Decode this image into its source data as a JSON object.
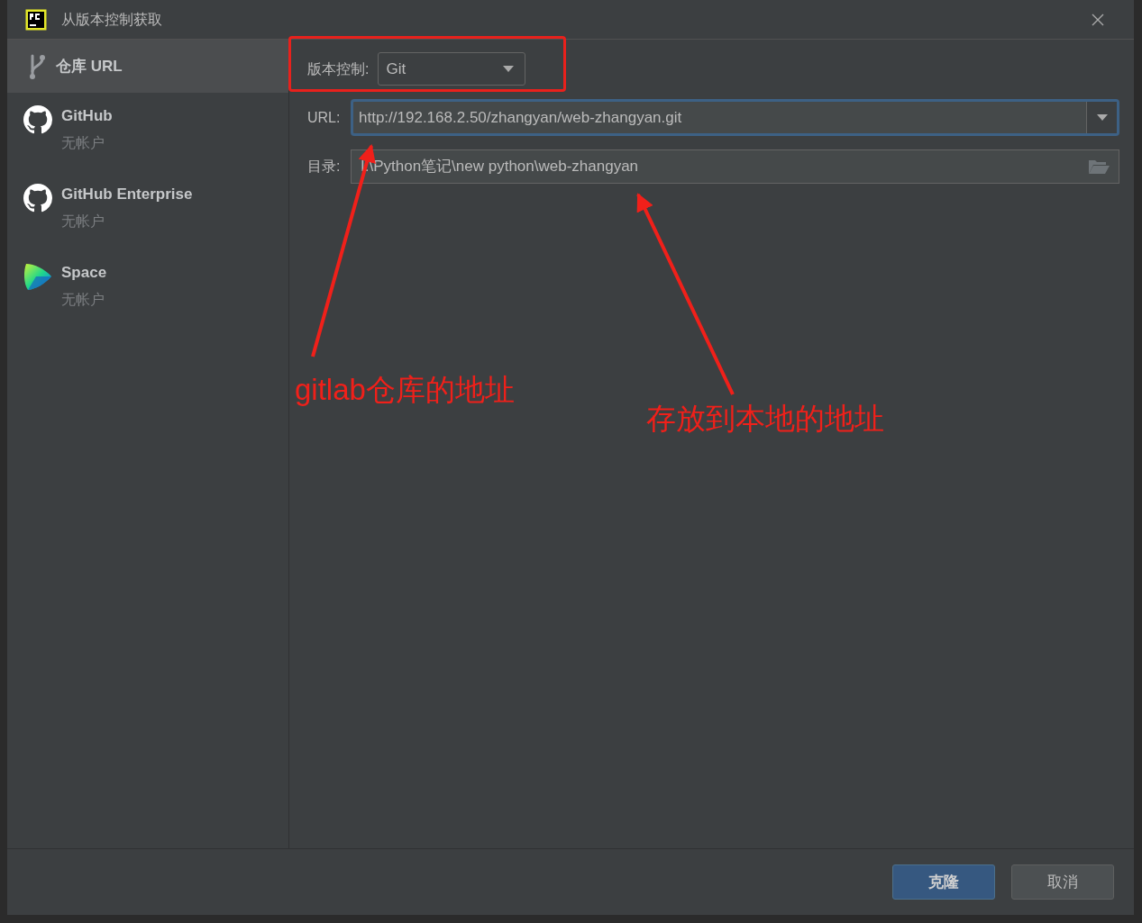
{
  "window": {
    "title": "从版本控制获取"
  },
  "sidebar": {
    "items": [
      {
        "kind": "url",
        "label": "仓库 URL",
        "selected": true
      },
      {
        "kind": "github",
        "label": "GitHub",
        "sublabel": "无帐户",
        "selected": false
      },
      {
        "kind": "github",
        "label": "GitHub Enterprise",
        "sublabel": "无帐户",
        "selected": false
      },
      {
        "kind": "space",
        "label": "Space",
        "sublabel": "无帐户",
        "selected": false
      }
    ]
  },
  "form": {
    "vcs_label": "版本控制:",
    "vcs_value": "Git",
    "url_label": "URL:",
    "url_value": "http://192.168.2.50/zhangyan/web-zhangyan.git",
    "url_focused": true,
    "dir_label": "目录:",
    "dir_value": "I:\\Python笔记\\new python\\web-zhangyan"
  },
  "annotations": [
    {
      "text": "gitlab仓库的地址"
    },
    {
      "text": "存放到本地的地址"
    }
  ],
  "buttons": [
    {
      "kind": "primary",
      "label": "克隆"
    },
    {
      "kind": "secondary",
      "label": "取消"
    }
  ]
}
